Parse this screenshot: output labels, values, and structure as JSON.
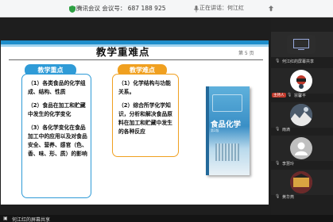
{
  "titlebar": {
    "meeting_title": "腾讯会议  会议号： 687 188 925",
    "speaking": "正在讲话：何江红",
    "shield_icon": "shield-icon",
    "mic_icon": "mic-icon",
    "pin_icon": "pin-icon"
  },
  "slide": {
    "title": "教学重难点",
    "page_num": "第 5 页",
    "left_header": "教学重点",
    "right_header": "教学难点",
    "left_items": [
      "（1）各类食品的化学组成、结构、性质",
      "（2）食品在加工和贮藏中发生的化学变化",
      "（3）各化学变化在食品加工中的应用以及对食品安全、营养、感官（色、香、味、形、质）的影响"
    ],
    "right_items": [
      "（1）化学结构与功能关系。",
      "（2）综合所学化学知识，分析和解决食品原料在加工和贮藏中发生的各种反应"
    ],
    "book_title": "食品化学",
    "book_sub": "第2版"
  },
  "participants": {
    "host_badge": "主持人",
    "items": [
      {
        "name": "何江红的屏幕共享",
        "avatar": "",
        "avatar_color": "#2d2d2d"
      },
      {
        "name": "宗馨平",
        "avatar": "",
        "avatar_color": "#ffffff"
      },
      {
        "name": "雨滴",
        "avatar": "",
        "avatar_color": "#5a6d80"
      },
      {
        "name": "李慧玲",
        "avatar": "",
        "avatar_color": "#bfbfbf"
      },
      {
        "name": "黄华燕",
        "avatar": "",
        "avatar_color": "#8b3a3a"
      }
    ]
  },
  "bottom_bar": {
    "share_label": "何江红的屏幕共享",
    "share_icon": "screen-share-icon"
  }
}
